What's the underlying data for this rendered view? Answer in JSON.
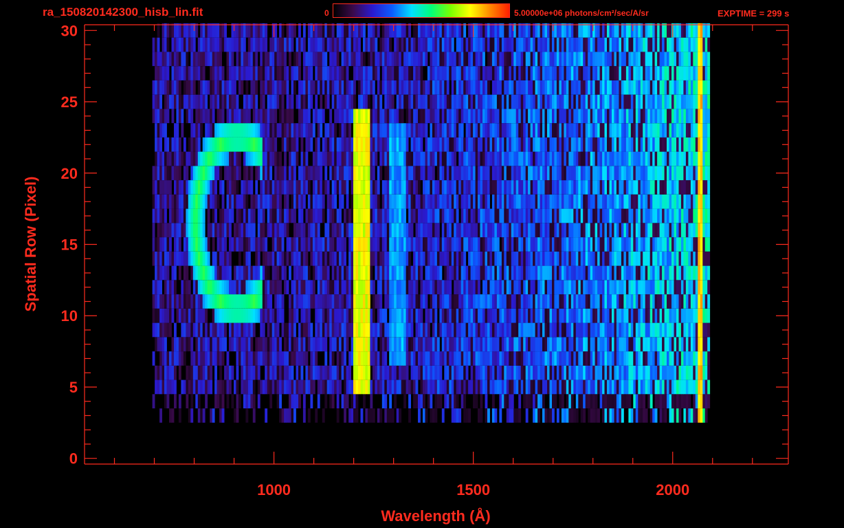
{
  "header": {
    "file_title": "ra_150820142300_hisb_lin.fit",
    "colorbar_min": "0",
    "colorbar_max": "5.00000e+06 photons/cm²/sec/A/sr",
    "exptime": "EXPTIME = 299 s"
  },
  "colors": {
    "axis": "#ff2b1e",
    "background": "#000000",
    "colorbar_stops": [
      "#000000",
      "#3a0a4a",
      "#2a1ad0",
      "#0b5cff",
      "#00e0ff",
      "#00ff7a",
      "#7aff00",
      "#ffff00",
      "#ff8a00",
      "#ff2000"
    ]
  },
  "chart_data": {
    "type": "heatmap",
    "title": "ra_150820142300_hisb_lin.fit",
    "xlabel": "Wavelength (Å)",
    "ylabel": "Spatial Row (Pixel)",
    "xlim": [
      525,
      2290
    ],
    "ylim": [
      -0.4,
      30.4
    ],
    "x_ticks": [
      1000,
      1500,
      2000
    ],
    "x_tick_labels": [
      "1000",
      "1500",
      "2000"
    ],
    "y_ticks": [
      0,
      5,
      10,
      15,
      20,
      25,
      30
    ],
    "y_tick_labels": [
      "0",
      "5",
      "10",
      "15",
      "20",
      "25",
      "30"
    ],
    "color_scale": {
      "min": 0,
      "max": 5000000,
      "unit": "photons/cm²/sec/A/sr"
    },
    "data_extent": {
      "x": [
        695,
        2090
      ],
      "rows": [
        3,
        30
      ]
    },
    "features": [
      {
        "name": "lyman-alpha-band",
        "center_x": 1215,
        "x_range": [
          1195,
          1240
        ],
        "rows": [
          5,
          24
        ],
        "intensity": 0.82
      },
      {
        "name": "secondary-band",
        "center_x": 1305,
        "x_range": [
          1285,
          1325
        ],
        "rows": [
          7,
          23
        ],
        "intensity": 0.45
      },
      {
        "name": "arc-feature",
        "center_x": 905,
        "center_row": 16.5,
        "radius_x": 105,
        "radius_row": 6,
        "intensity": 0.6
      },
      {
        "name": "red-edge-line",
        "center_x": 2065,
        "x_range": [
          2058,
          2072
        ],
        "rows": [
          2,
          30
        ],
        "intensity": 0.88
      }
    ],
    "grid": false,
    "legend": "colorbar-top"
  }
}
